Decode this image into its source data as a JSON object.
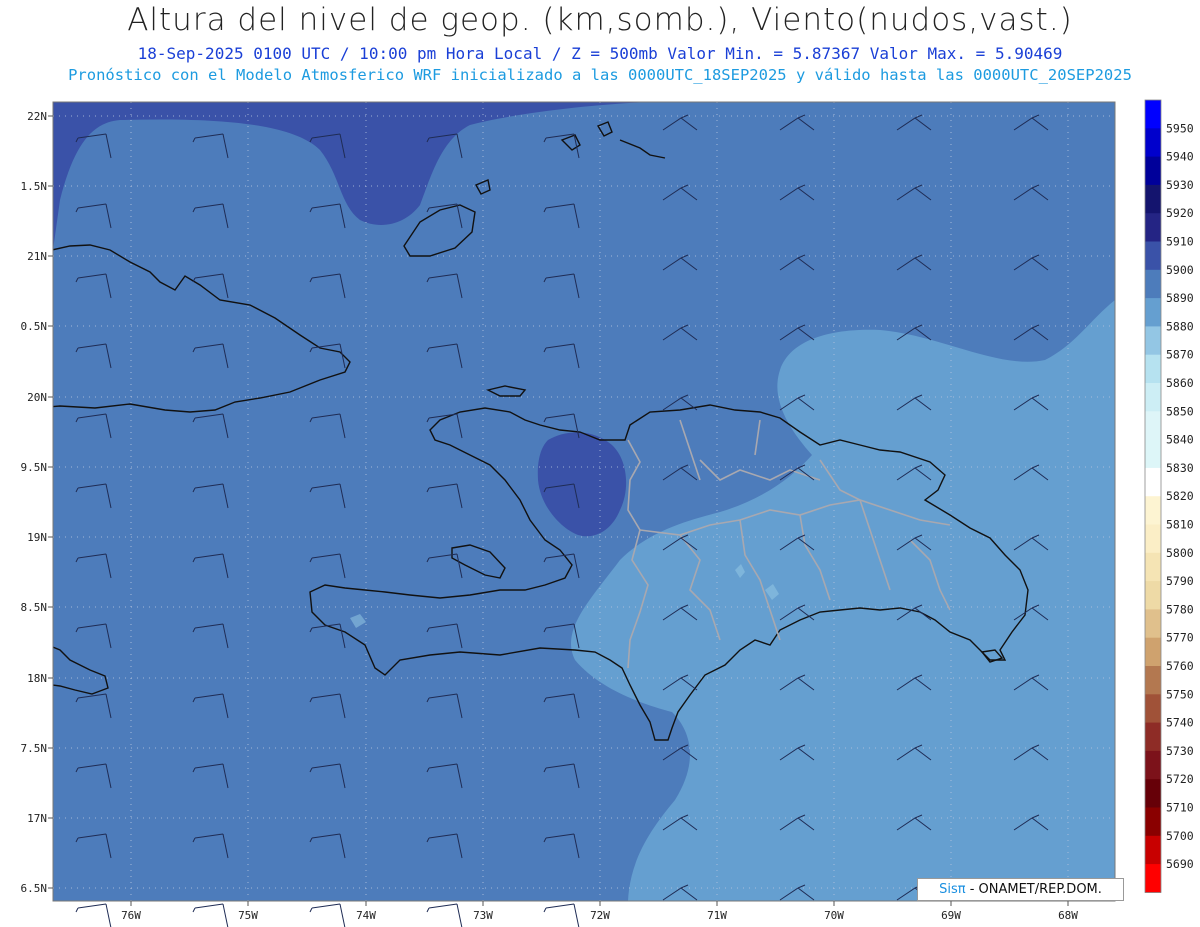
{
  "title": {
    "line1": "Altura del nivel de geop. (km,somb.), Viento(nudos,vast.)",
    "line2": "18-Sep-2025  0100 UTC / 10:00 pm Hora Local / Z = 500mb    Valor Min. = 5.87367  Valor Max. = 5.90469",
    "line3": "Pronóstico con el Modelo Atmosferico WRF inicializado a las 0000UTC_18SEP2025 y válido hasta las  0000UTC_20SEP2025"
  },
  "map": {
    "lat_labels": [
      "22N",
      "1.5N",
      "21N",
      "0.5N",
      "20N",
      "9.5N",
      "19N",
      "8.5N",
      "18N",
      "7.5N",
      "17N",
      "6.5N"
    ],
    "lon_labels": [
      "76W",
      "75W",
      "74W",
      "73W",
      "72W",
      "71W",
      "70W",
      "69W",
      "68W"
    ]
  },
  "colorbar": {
    "levels": [
      5950,
      5940,
      5930,
      5920,
      5910,
      5900,
      5890,
      5880,
      5870,
      5860,
      5850,
      5840,
      5830,
      5820,
      5810,
      5800,
      5790,
      5780,
      5770,
      5760,
      5750,
      5740,
      5730,
      5720,
      5710,
      5700,
      5690
    ],
    "colors": [
      "#0000ff",
      "#0000cc",
      "#00009a",
      "#14146e",
      "#242484",
      "#3a52a8",
      "#4d7cbb",
      "#659fd0",
      "#93c6e4",
      "#b6e2f0",
      "#cdeef5",
      "#def5f8",
      "#ddf6f8",
      "#ffffff",
      "#fdf4d2",
      "#fbeec6",
      "#f5e4b4",
      "#eedaa6",
      "#e0c08c",
      "#cfa26e",
      "#b37850",
      "#a05238",
      "#8e2c26",
      "#7c121a",
      "#660008",
      "#8a0000",
      "#c80000",
      "#ff0000"
    ]
  },
  "credit": {
    "brand": "Sisπ",
    "text": "- ONAMET/REP.DOM."
  }
}
